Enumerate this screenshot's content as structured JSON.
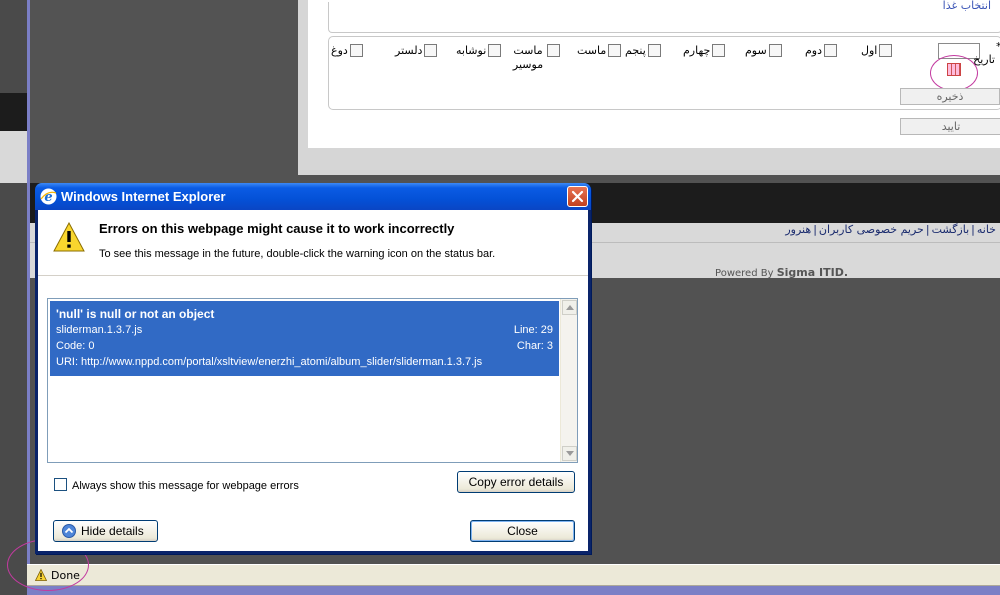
{
  "background_page": {
    "meal_section_legend": "انتخاب غذا",
    "date_label": "تاریخ",
    "required_mark": "*",
    "food_items": [
      {
        "label": "اول"
      },
      {
        "label": "دوم"
      },
      {
        "label": "سوم"
      },
      {
        "label": "چهارم"
      },
      {
        "label": "پنجم"
      },
      {
        "label": "ماست"
      },
      {
        "label": "ماست موسیر"
      },
      {
        "label": "نوشابه"
      },
      {
        "label": "دلستر"
      },
      {
        "label": "دوغ"
      }
    ],
    "save_label": "ذخیره",
    "confirm_label": "تایید",
    "footer_links": [
      "خانه",
      "بازگشت",
      "حریم خصوصی کاربران",
      "هنرور"
    ],
    "powered_by_prefix": "Powered By",
    "powered_by_brand": "Sigma ITID."
  },
  "dialog": {
    "title": "Windows Internet Explorer",
    "headline": "Errors on this webpage might cause it to work incorrectly",
    "subline": "To see this message in the future, double-click the warning icon on the status bar.",
    "error": {
      "title": "'null' is null or not an object",
      "file": "sliderman.1.3.7.js",
      "line": "Line: 29",
      "code": "Code: 0",
      "char": "Char: 3",
      "uri": "URI: http://www.nppd.com/portal/xsltview/enerzhi_atomi/album_slider/sliderman.1.3.7.js"
    },
    "always_show_label": "Always show this message for webpage errors",
    "copy_details_label": "Copy error details",
    "hide_details_label": "Hide details",
    "close_label": "Close"
  },
  "status_bar": {
    "text": "Done"
  },
  "colors": {
    "title_bar": "#0b5ce4",
    "error_highlight": "#316ac5",
    "annotation_circle": "#c33aa0",
    "link_text": "#1a2b6e"
  },
  "icons": [
    "ie-logo-icon",
    "close-x-icon",
    "warning-triangle-icon",
    "calendar-icon",
    "chevron-up-icon",
    "scroll-up-icon",
    "scroll-down-icon"
  ]
}
